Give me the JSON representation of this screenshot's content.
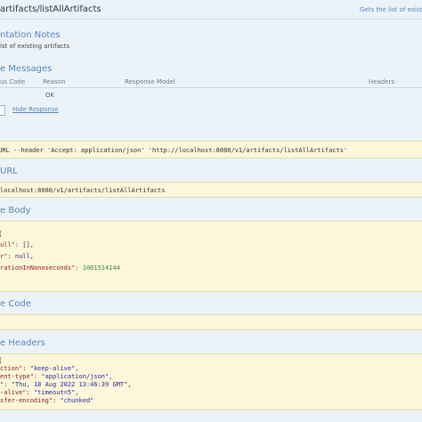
{
  "operation": {
    "path": "artifacts/listAllArtifacts",
    "summary": "Gets the list of existi"
  },
  "implementation_notes": {
    "title": "ntation Notes",
    "text": "ist of existing artifacts"
  },
  "response_messages": {
    "title": "e Messages",
    "headers": [
      "us Code",
      "Reason",
      "Response Model",
      "Headers"
    ],
    "rows": [
      {
        "reason": "OK"
      }
    ],
    "hide_response": "Hide Response"
  },
  "curl": {
    "command": "cURL --header 'Accept: application/json' 'http://localhost:8080/v1/artifacts/listAllArtifacts'"
  },
  "request_url": {
    "title": "URL",
    "value": "localhost:8080/v1/artifacts/listAllArtifacts"
  },
  "response_body": {
    "title": "e Body",
    "open_brace": "{",
    "lines": [
      {
        "key": "ull\":",
        "value": "[],",
        "kind": "plain"
      },
      {
        "key": "r\":",
        "value": "null,",
        "kind": "str"
      },
      {
        "key": "rationInNanoseconds\":",
        "value": "1001514144",
        "kind": "num"
      }
    ]
  },
  "response_code": {
    "title": "e Code",
    "value": ""
  },
  "response_headers": {
    "title": "e Headers",
    "open_brace": "{",
    "lines": [
      {
        "key": "ction\":",
        "value": "\"keep-alive\","
      },
      {
        "key": "ent-type\":",
        "value": "\"application/json\","
      },
      {
        "key": "\":",
        "value": "\"Thu, 18 Aug 2022 13:46:39 GMT\","
      },
      {
        "key": "-alive\":",
        "value": "\"timeout=5\","
      },
      {
        "key": "sfer-encoding\":",
        "value": "\"chunked\""
      }
    ]
  }
}
